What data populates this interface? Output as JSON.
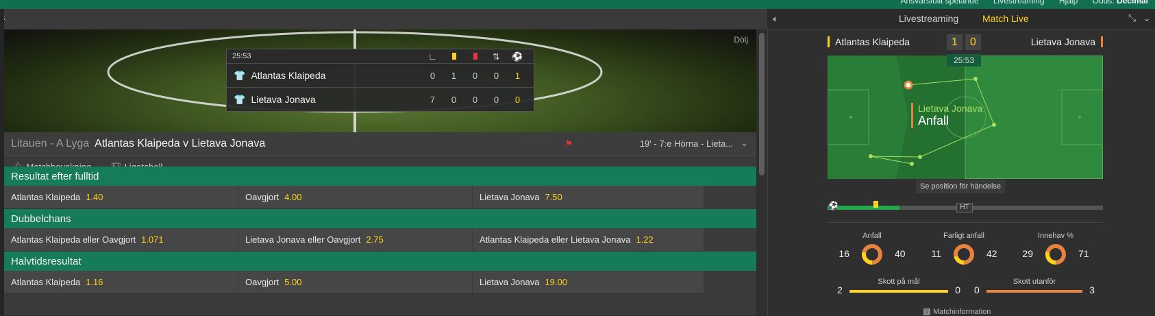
{
  "top_links": {
    "items": [
      "Ansvarsfullt spelande",
      "Livestreaming",
      "Hjälp",
      "Odds"
    ],
    "active": "Decimal"
  },
  "left_stub": "a",
  "banner": {
    "hide_label": "Dölj"
  },
  "scoreboard": {
    "clock": "25:53",
    "columns": [
      "corner-icon",
      "yellow-card-icon",
      "red-card-icon",
      "substitution-icon",
      "goal-icon"
    ],
    "rows": [
      {
        "team": "Atlantas Klaipeda",
        "shirt_color": "#ffd21e",
        "stats": [
          "0",
          "1",
          "0",
          "0",
          "1"
        ]
      },
      {
        "team": "Lietava Jonava",
        "shirt_color": "#e8823f",
        "stats": [
          "7",
          "0",
          "0",
          "0",
          "0"
        ]
      }
    ]
  },
  "match": {
    "league": "Litauen - A Lyga",
    "title": "Atlantas Klaipeda v Lietava Jonava",
    "last_event": "19' - 7:e Hörna - Lieta..."
  },
  "tools": {
    "alert": "Matchbevakning",
    "table": "Ligatabell"
  },
  "markets": [
    {
      "title": "Resultat efter fulltid",
      "selections": [
        {
          "label": "Atlantas Klaipeda",
          "price": "1.40"
        },
        {
          "label": "Oavgjort",
          "price": "4.00"
        },
        {
          "label": "Lietava Jonava",
          "price": "7.50"
        }
      ]
    },
    {
      "title": "Dubbelchans",
      "selections": [
        {
          "label": "Atlantas Klaipeda eller Oavgjort",
          "price": "1.071"
        },
        {
          "label": "Lietava Jonava eller Oavgjort",
          "price": "2.75"
        },
        {
          "label": "Atlantas Klaipeda eller Lietava Jonava",
          "price": "1.22"
        }
      ]
    },
    {
      "title": "Halvtidsresultat",
      "selections": [
        {
          "label": "Atlantas Klaipeda",
          "price": "1.16"
        },
        {
          "label": "Oavgjort",
          "price": "5.00"
        },
        {
          "label": "Lietava Jonava",
          "price": "19.00"
        }
      ]
    }
  ],
  "right_tabs": {
    "stream": "Livestreaming",
    "live": "Match Live"
  },
  "live": {
    "home": "Atlantas Klaipeda",
    "away": "Lietava Jonava",
    "home_score": "1",
    "away_score": "0",
    "clock": "25:53",
    "event_team": "Lietava Jonava",
    "event_kind": "Anfall",
    "position_hint": "Se position för händelse",
    "half_label": "HT",
    "elapsed_fraction": 0.26
  },
  "stats": {
    "attacks": {
      "label": "Anfall",
      "home": "16",
      "away": "40"
    },
    "dangerous": {
      "label": "Farligt anfall",
      "home": "11",
      "away": "42"
    },
    "possession": {
      "label": "Innehav %",
      "home": "29",
      "away": "71"
    },
    "on_target": {
      "label": "Skott på mål",
      "home": "2",
      "away": "0"
    },
    "off_target": {
      "label": "Skott utanför",
      "home": "0",
      "away": "3"
    }
  },
  "match_info": "Matchinformation",
  "colors": {
    "home": "#ffd21e",
    "away": "#e8823f",
    "accent": "#ffd21e",
    "market_header": "#167b59",
    "brand_green": "#126e51"
  }
}
